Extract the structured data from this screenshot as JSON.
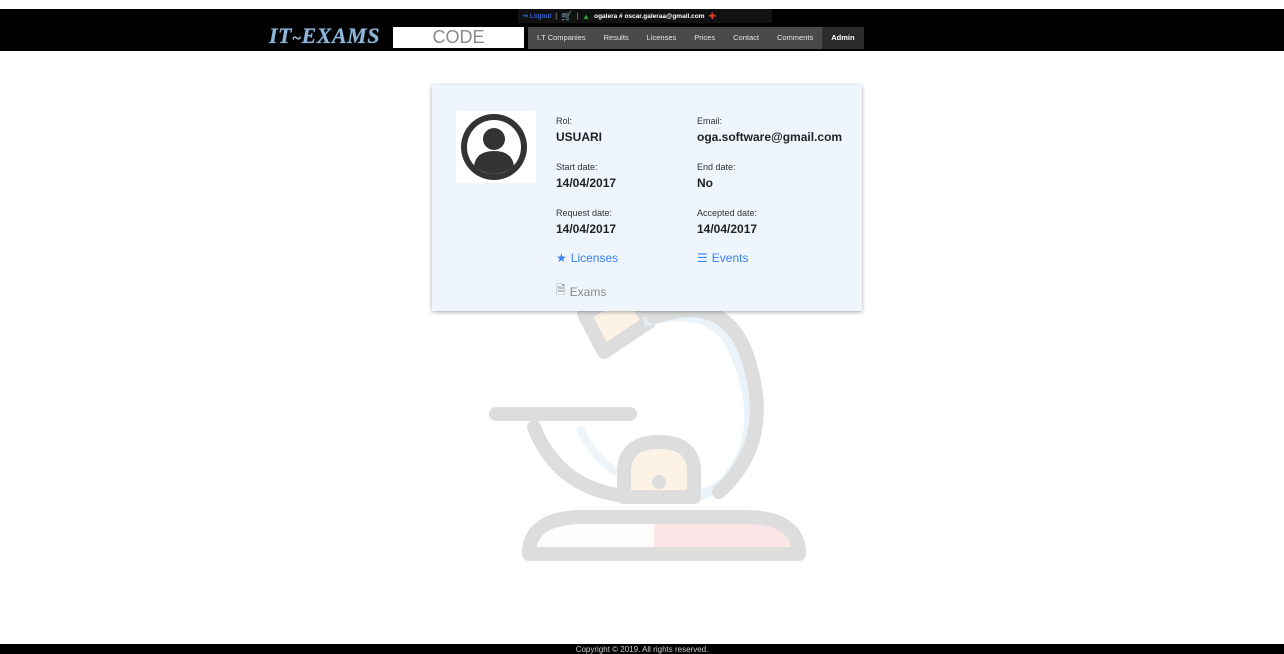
{
  "header": {
    "logout_label": "Logout",
    "separator": "|",
    "account_text": "ogalera # oscar.galeraa@gmail.com",
    "logo_text": "IT",
    "logo_tilde": "~",
    "logo_text2": "EXAMS",
    "search_placeholder": "CODE",
    "nav": [
      {
        "label": "I.T Companies"
      },
      {
        "label": "Results"
      },
      {
        "label": "Licenses"
      },
      {
        "label": "Prices"
      },
      {
        "label": "Contact"
      },
      {
        "label": "Comments"
      },
      {
        "label": "Admin",
        "active": true
      }
    ]
  },
  "profile": {
    "rol_label": "Rol:",
    "rol_value": "USUARI",
    "email_label": "Email:",
    "email_value": "oga.software@gmail.com",
    "start_label": "Start date:",
    "start_value": "14/04/2017",
    "end_label": "End date:",
    "end_value": "No",
    "request_label": "Request date:",
    "request_value": "14/04/2017",
    "accepted_label": "Accepted date:",
    "accepted_value": "14/04/2017",
    "licenses_link": "Licenses",
    "events_link": "Events",
    "exams_link": "Exams"
  },
  "footer": {
    "copyright": "Copyright © 2019. All rights reserved."
  },
  "colors": {
    "link_blue": "#3a82f0",
    "card_bg": "#eef5fc",
    "header_bg": "#000000"
  },
  "icons": [
    "logout-icon",
    "cart-icon",
    "user-icon",
    "pin-icon",
    "avatar-icon",
    "star-icon",
    "list-icon",
    "document-icon",
    "microscope-icon"
  ]
}
